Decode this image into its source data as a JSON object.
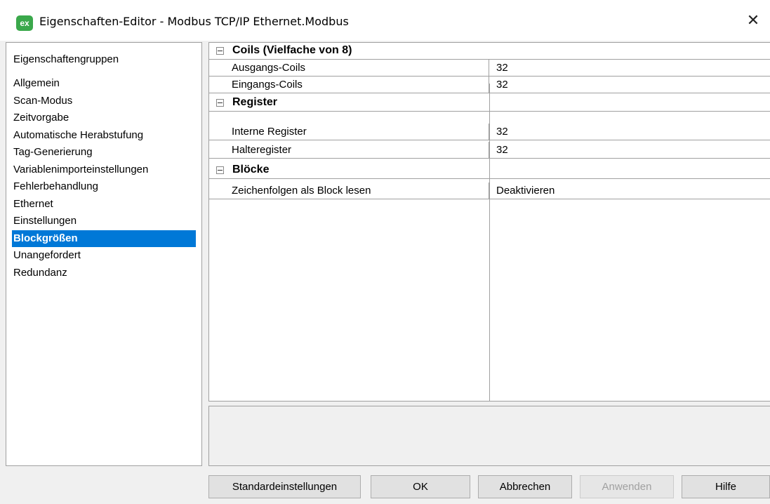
{
  "window": {
    "icon_label": "ex",
    "title": "Eigenschaften-Editor - Modbus TCP/IP Ethernet.Modbus",
    "close_label": "✕"
  },
  "groups": {
    "header": "Eigenschaftengruppen",
    "items": [
      {
        "label": "Allgemein",
        "selected": false
      },
      {
        "label": "Scan-Modus",
        "selected": false
      },
      {
        "label": "Zeitvorgabe",
        "selected": false
      },
      {
        "label": "Automatische Herabstufung",
        "selected": false
      },
      {
        "label": "Tag-Generierung",
        "selected": false
      },
      {
        "label": "Variablenimporteinstellungen",
        "selected": false
      },
      {
        "label": "Fehlerbehandlung",
        "selected": false
      },
      {
        "label": "Ethernet",
        "selected": false
      },
      {
        "label": "Einstellungen",
        "selected": false
      },
      {
        "label": "Blockgrößen",
        "selected": true
      },
      {
        "label": "Unangefordert",
        "selected": false
      },
      {
        "label": "Redundanz",
        "selected": false
      }
    ]
  },
  "properties": {
    "categories": [
      {
        "label": "Coils (Vielfache von 8)",
        "rows": [
          {
            "name": "Ausgangs-Coils",
            "value": "32"
          },
          {
            "name": "Eingangs-Coils",
            "value": "32"
          }
        ]
      },
      {
        "label": "Register",
        "rows": [
          {
            "name": "Interne Register",
            "value": "32"
          },
          {
            "name": "Halteregister",
            "value": "32"
          }
        ]
      },
      {
        "label": "Blöcke",
        "rows": [
          {
            "name": "Zeichenfolgen als Block lesen",
            "value": "Deaktivieren"
          }
        ]
      }
    ]
  },
  "buttons": {
    "defaults": "Standardeinstellungen",
    "ok": "OK",
    "cancel": "Abbrechen",
    "apply": "Anwenden",
    "help": "Hilfe"
  },
  "colors": {
    "selection": "#0078d7",
    "window_bg": "#f0f0f0",
    "app_icon": "#3aa84b"
  }
}
